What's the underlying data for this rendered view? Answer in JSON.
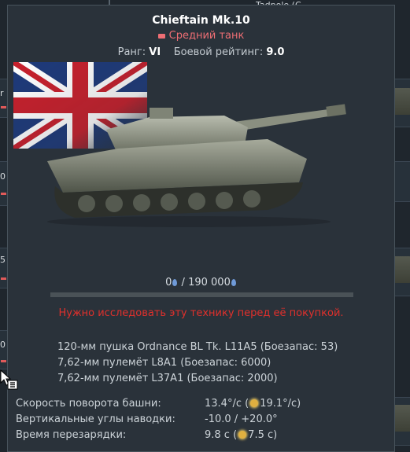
{
  "background": {
    "top_text": "Tadpole (C",
    "side_values": [
      "r",
      "0",
      "5",
      "0"
    ]
  },
  "tooltip": {
    "vehicle_name": "Chieftain Mk.10",
    "vehicle_type": "Средний танк",
    "rank_label": "Ранг:",
    "rank_value": "VI",
    "br_label": "Боевой рейтинг:",
    "br_value": "9.0",
    "research": {
      "current": "0",
      "separator": " / ",
      "total": "190 000",
      "progress": 0
    },
    "warning": "Нужно исследовать эту технику перед её покупкой.",
    "weapons": [
      "120-мм пушка Ordnance BL Tk. L11A5 (Боезапас: 53)",
      "7,62-мм пулемёт L8A1 (Боезапас: 6000)",
      "7,62-мм пулемёт L37A1 (Боезапас: 2000)"
    ],
    "stats": [
      {
        "label": "Скорость поворота башни:",
        "value_main": "13.4°/с (",
        "value_boost": "19.1°/с)"
      },
      {
        "label": "Вертикальные углы наводки:",
        "value_main": "-10.0 / +20.0°",
        "value_boost": ""
      },
      {
        "label": "Время перезарядки:",
        "value_main": "9.8 с (",
        "value_boost": "7.5 с)"
      }
    ]
  },
  "colors": {
    "type_color": "#ee6e74",
    "warning_color": "#e0302c",
    "panel_bg": "#2a323a"
  },
  "icons": [
    "uk-flag",
    "tank-image",
    "research-point-icon",
    "ace-crew-icon",
    "pointer-cursor-icon"
  ]
}
